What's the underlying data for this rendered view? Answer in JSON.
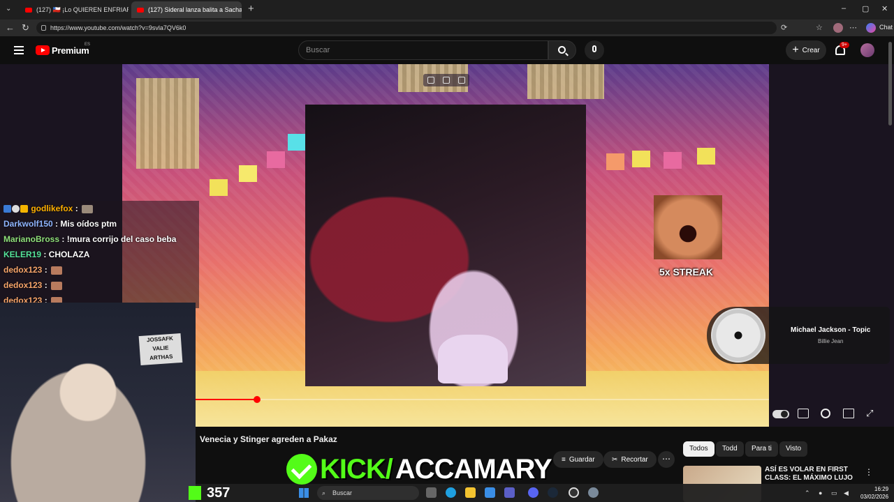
{
  "browser": {
    "tabs": [
      {
        "label": "(127) 🇨🇱 ¡Lo QUIEREN ENFRIAR!",
        "active": false
      },
      {
        "label": "(127) Sideral lanza balita a Sacha |",
        "active": true
      }
    ],
    "new_tab": "+",
    "url": "https://www.youtube.com/watch?v=9svla7QV6k0",
    "chat_button": "Chat",
    "window_controls": {
      "minimize": "–",
      "maximize": "▢",
      "close": "✕"
    }
  },
  "header": {
    "brand": "Premium",
    "region": "ES",
    "search_placeholder": "Buscar",
    "create_label": "Crear",
    "notifications": "9+"
  },
  "player": {
    "streak_text": "5x STREAK",
    "music_artist": "Michael Jackson - Topic",
    "music_track": "Billie Jean",
    "progress": 0.107
  },
  "chat": [
    {
      "user": "godlikefox",
      "color": "#ffb000",
      "text": ":",
      "emote": true,
      "badges": true
    },
    {
      "user": "Darkwolf150",
      "color": "#8fb5ff",
      "text": ": Mis oídos ptm",
      "emote": false
    },
    {
      "user": "MarianoBross",
      "color": "#8fe07a",
      "text": ": !mura corrijo del caso beba",
      "emote": false
    },
    {
      "user": "KELER19",
      "color": "#55e39a",
      "text": ": CHOLAZA",
      "emote": false
    },
    {
      "user": "dedox123",
      "color": "#f7a56a",
      "text": ":",
      "emote": true
    },
    {
      "user": "dedox123",
      "color": "#f7a56a",
      "text": ":",
      "emote": true
    },
    {
      "user": "dedox123",
      "color": "#f7a56a",
      "text": ":",
      "emote": true
    }
  ],
  "webcam_sign": [
    "JOSSAFK",
    "VALIE",
    "ARTHAS"
  ],
  "video": {
    "title": "Venecia y Stinger agreden a Pakaz",
    "save_label": "Guardar",
    "clip_label": "Recortar",
    "more_label": "⋯"
  },
  "filters": [
    "Todos",
    "Todd",
    "Para ti",
    "Visto"
  ],
  "recommendation": {
    "title": "ASÍ ES VOLAR EN FIRST CLASS: EL MÁXIMO LUJO"
  },
  "kick": {
    "label": "KICK/",
    "handle": "ACCAMARY",
    "viewers": "357"
  },
  "taskbar": {
    "search_label": "Buscar",
    "time": "16:29",
    "date": "03/02/2026"
  },
  "colors": {
    "youtube_red": "#ff0000",
    "kick_green": "#53fc18"
  }
}
